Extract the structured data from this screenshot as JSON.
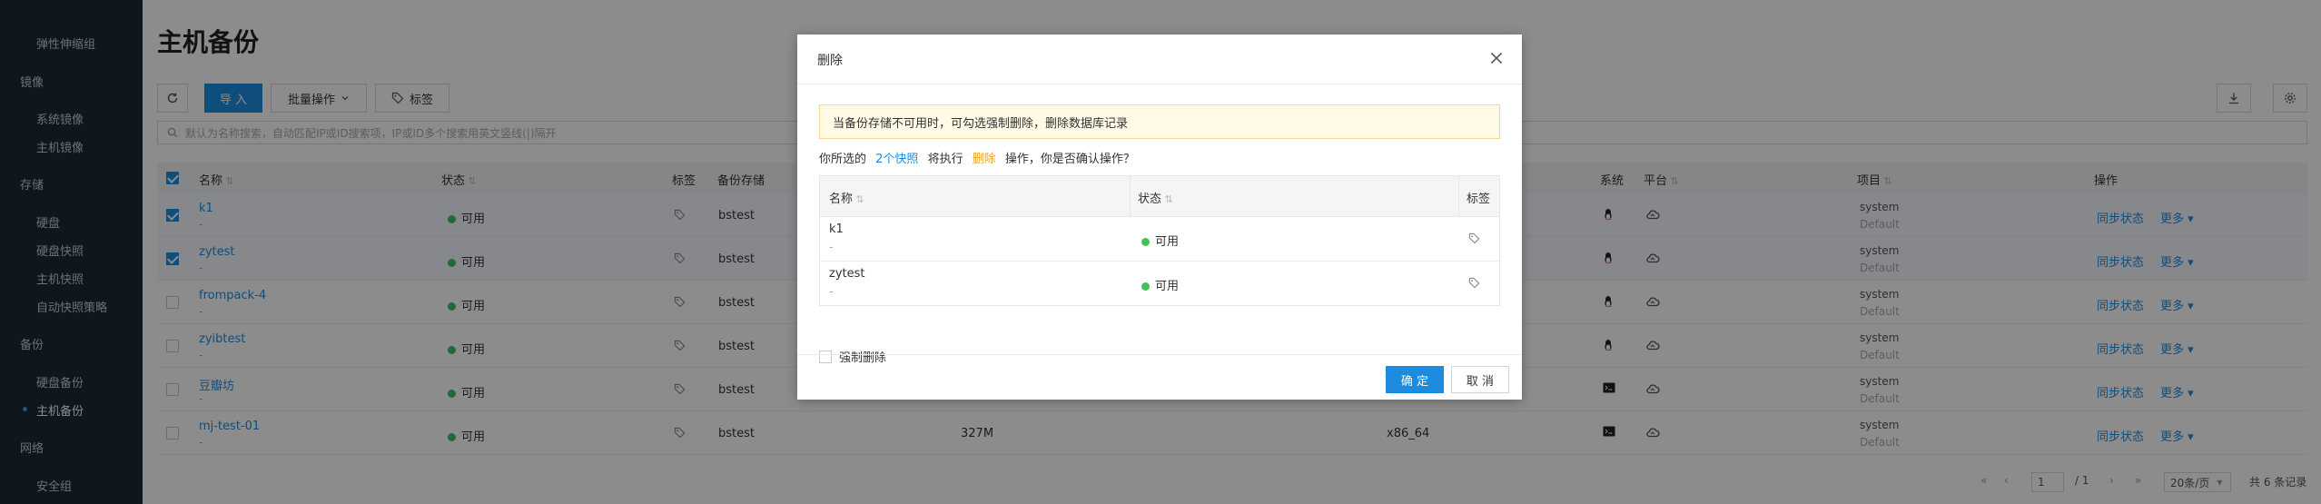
{
  "sidebar": {
    "items": [
      {
        "label": "弹性伸缩组",
        "type": "item"
      },
      {
        "label": "镜像",
        "type": "group"
      },
      {
        "label": "系统镜像",
        "type": "item"
      },
      {
        "label": "主机镜像",
        "type": "item"
      },
      {
        "label": "存储",
        "type": "group"
      },
      {
        "label": "硬盘",
        "type": "item"
      },
      {
        "label": "硬盘快照",
        "type": "item"
      },
      {
        "label": "主机快照",
        "type": "item"
      },
      {
        "label": "自动快照策略",
        "type": "item"
      },
      {
        "label": "备份",
        "type": "group"
      },
      {
        "label": "硬盘备份",
        "type": "item"
      },
      {
        "label": "主机备份",
        "type": "item",
        "active": true
      },
      {
        "label": "网络",
        "type": "group"
      },
      {
        "label": "安全组",
        "type": "item"
      }
    ]
  },
  "page": {
    "title": "主机备份"
  },
  "toolbar": {
    "import_label": "导 入",
    "batch_label": "批量操作",
    "tags_label": "标签"
  },
  "search": {
    "placeholder": "默认为名称搜索，自动匹配IP或ID搜索项，IP或ID多个搜索用英文竖线(|)隔开"
  },
  "table": {
    "headers": {
      "name": "名称",
      "status": "状态",
      "tags": "标签",
      "backup_storage": "备份存储",
      "system": "系统",
      "platform": "平台",
      "project": "项目",
      "actions": "操作"
    },
    "rows": [
      {
        "name": "k1",
        "sub": "-",
        "status": "可用",
        "storage": "bstest",
        "size": "",
        "arch": "",
        "os": "linux",
        "project": "system",
        "domain": "Default",
        "selected": true
      },
      {
        "name": "zytest",
        "sub": "-",
        "status": "可用",
        "storage": "bstest",
        "size": "",
        "arch": "",
        "os": "linux",
        "project": "system",
        "domain": "Default",
        "selected": true
      },
      {
        "name": "frompack-4",
        "sub": "-",
        "status": "可用",
        "storage": "bstest",
        "size": "",
        "arch": "",
        "os": "linux",
        "project": "system",
        "domain": "Default",
        "selected": false
      },
      {
        "name": "zyibtest",
        "sub": "-",
        "status": "可用",
        "storage": "bstest",
        "size": "",
        "arch": "",
        "os": "linux",
        "project": "system",
        "domain": "Default",
        "selected": false
      },
      {
        "name": "豆瓣坊",
        "sub": "-",
        "status": "可用",
        "storage": "bstest",
        "size": "",
        "arch": "",
        "os": "terminal",
        "project": "system",
        "domain": "Default",
        "selected": false
      },
      {
        "name": "mj-test-01",
        "sub": "-",
        "status": "可用",
        "storage": "bstest",
        "size": "327M",
        "arch": "x86_64",
        "os": "terminal",
        "project": "system",
        "domain": "Default",
        "selected": false
      }
    ],
    "action_sync": "同步状态",
    "action_more": "更多"
  },
  "pager": {
    "page": "1",
    "total_pages": "/ 1",
    "page_size": "20条/页",
    "total": "共 6 条记录"
  },
  "modal": {
    "title": "删除",
    "warning": "当备份存储不可用时，可勾选强制删除，删除数据库记录",
    "confirm_prefix": "你所选的",
    "confirm_count": "2个快照",
    "confirm_mid": "将执行",
    "confirm_action": "删除",
    "confirm_suffix": "操作，你是否确认操作？",
    "headers": {
      "name": "名称",
      "status": "状态",
      "tags": "标签"
    },
    "rows": [
      {
        "name": "k1",
        "sub": "-",
        "status": "可用"
      },
      {
        "name": "zytest",
        "sub": "-",
        "status": "可用"
      }
    ],
    "force_label": "强制删除",
    "ok_label": "确 定",
    "cancel_label": "取 消"
  },
  "colors": {
    "primary": "#1d8ce0",
    "status_green": "#43c05b",
    "warning_bg": "#fff9e6",
    "sidebar_bg": "#1b2838"
  }
}
